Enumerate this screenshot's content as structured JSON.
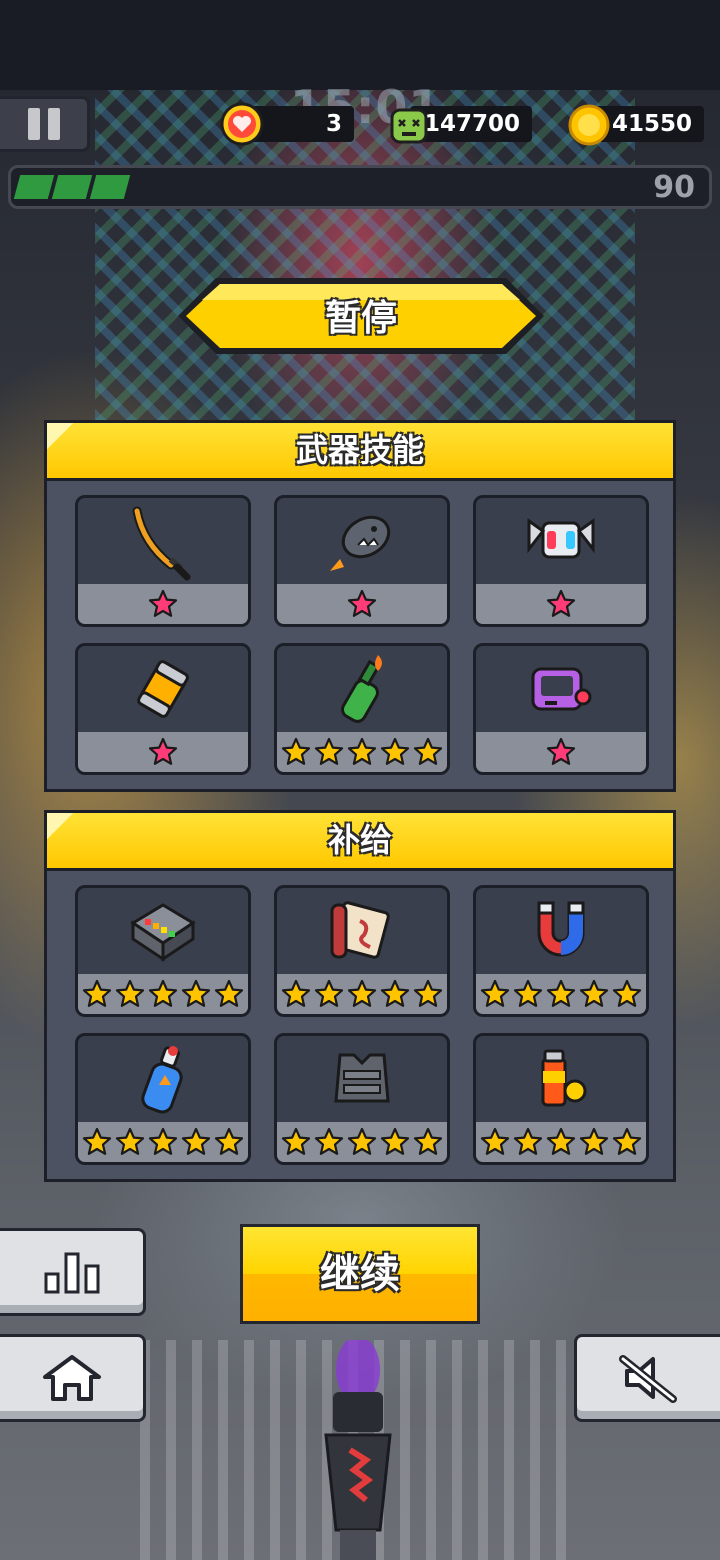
{
  "hud": {
    "timer": "15:01",
    "lives": "3",
    "kills": "147700",
    "coins": "41550",
    "level": "90",
    "xp_progress": 0.17
  },
  "pause_title": "暂停",
  "weapons_panel": {
    "title": "武器技能",
    "items": [
      {
        "icon": "katana-icon",
        "stars": 1,
        "star_color": "#ff3c78"
      },
      {
        "icon": "shark-rocket-icon",
        "stars": 1,
        "star_color": "#ff3c78"
      },
      {
        "icon": "robot-drone-icon",
        "stars": 1,
        "star_color": "#ff3c78"
      },
      {
        "icon": "energy-canister-icon",
        "stars": 1,
        "star_color": "#ff3c78"
      },
      {
        "icon": "molotov-bottle-icon",
        "stars": 5,
        "star_color": "#ffc400"
      },
      {
        "icon": "game-console-icon",
        "stars": 1,
        "star_color": "#ff3c78"
      }
    ]
  },
  "supply_panel": {
    "title": "补给",
    "items": [
      {
        "icon": "battery-pack-icon",
        "stars": 5,
        "star_color": "#ffc400"
      },
      {
        "icon": "ninja-scroll-icon",
        "stars": 5,
        "star_color": "#ffc400"
      },
      {
        "icon": "magnet-icon",
        "stars": 5,
        "star_color": "#ffc400"
      },
      {
        "icon": "potion-bottle-icon",
        "stars": 5,
        "star_color": "#ffc400"
      },
      {
        "icon": "armor-vest-icon",
        "stars": 5,
        "star_color": "#ffc400"
      },
      {
        "icon": "energy-cell-icon",
        "stars": 5,
        "star_color": "#ffc400"
      }
    ]
  },
  "continue_label": "继续",
  "colors": {
    "accent_yellow": "#ffc800",
    "panel_bg": "#4c5262",
    "pink_star": "#ff3c78",
    "gold_star": "#ffc400"
  }
}
